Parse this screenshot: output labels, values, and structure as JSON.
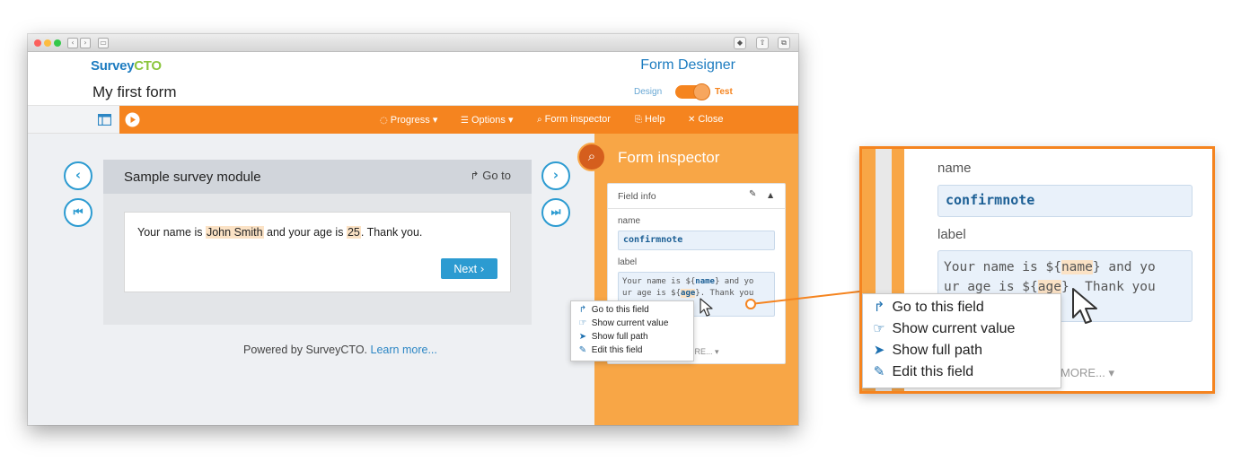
{
  "browser": {
    "back": "‹",
    "forward": "›"
  },
  "header": {
    "logo_a": "Survey",
    "logo_b": "CTO",
    "designer_title": "Form Designer",
    "form_title": "My first form",
    "design_label": "Design",
    "test_label": "Test"
  },
  "toolbar": {
    "progress": "Progress",
    "options": "Options",
    "form_inspector": "Form inspector",
    "help": "Help",
    "close": "Close"
  },
  "module": {
    "title": "Sample survey module",
    "goto": "Go to",
    "text_a": "Your name is ",
    "name_value": "John Smith",
    "text_b": " and your age is ",
    "age_value": "25",
    "text_c": ". Thank you.",
    "next": "Next"
  },
  "footer": {
    "powered": "Powered by SurveyCTO.",
    "learn_more": "Learn more..."
  },
  "inspector": {
    "title": "Form inspector",
    "field_info": "Field info",
    "name_label": "name",
    "name_value": "confirmnote",
    "label_label": "label",
    "label_line1_a": "Your name is ${",
    "label_name_token": "name",
    "label_line1_b": "} and yo",
    "label_line2_a": "ur age is ${",
    "label_age_token": "age",
    "label_line2_b": "}. Thank you",
    "more": "MORE..."
  },
  "context_menu": {
    "items": [
      "Go to this field",
      "Show current value",
      "Show full path",
      "Edit this field"
    ]
  },
  "colors": {
    "brand_orange": "#f5841f",
    "brand_blue": "#2c9bd1",
    "highlight": "#fbe2c5"
  }
}
